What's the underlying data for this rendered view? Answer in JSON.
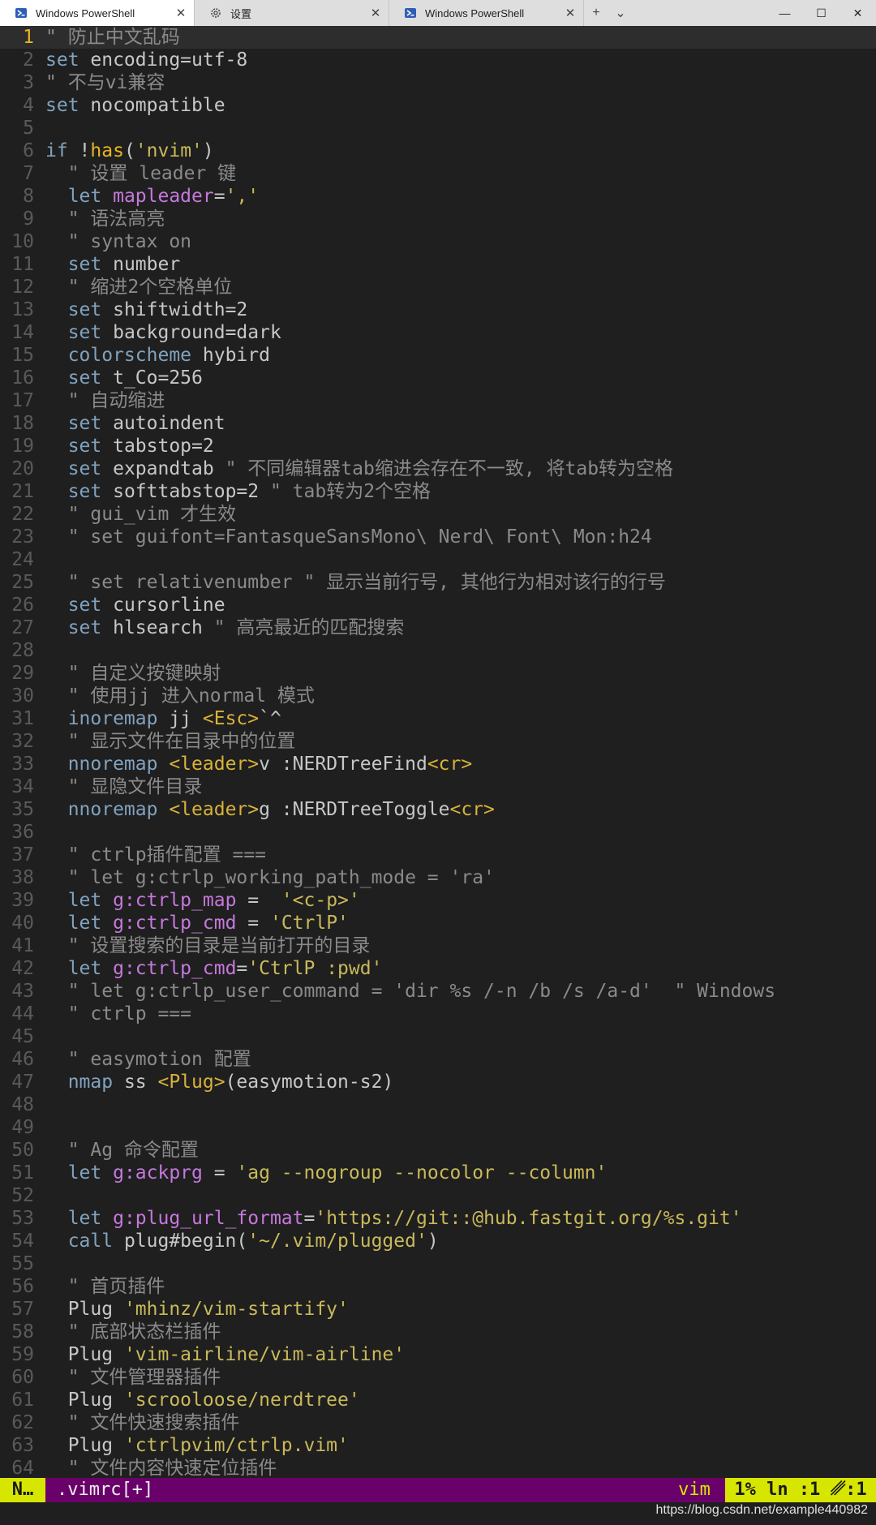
{
  "tabs": [
    {
      "label": "Windows PowerShell",
      "icon": "powershell-icon",
      "active": true
    },
    {
      "label": "设置",
      "icon": "gear-icon",
      "active": false
    },
    {
      "label": "Windows PowerShell",
      "icon": "powershell-icon",
      "active": false
    }
  ],
  "tab_close_glyph": "✕",
  "new_tab_glyph": "+",
  "dropdown_glyph": "⌄",
  "window_controls": {
    "minimize": "—",
    "maximize": "☐",
    "close": "✕"
  },
  "editor_lines": [
    [
      [
        "c",
        "\" 防止中文乱码"
      ]
    ],
    [
      [
        "k",
        "set "
      ],
      [
        "o",
        "encoding=utf-8"
      ]
    ],
    [
      [
        "c",
        "\" 不与vi兼容"
      ]
    ],
    [
      [
        "k",
        "set "
      ],
      [
        "o",
        "nocompatible"
      ]
    ],
    [],
    [
      [
        "k",
        "if "
      ],
      [
        "o",
        "!"
      ],
      [
        "f",
        "has"
      ],
      [
        "o",
        "("
      ],
      [
        "s",
        "'nvim'"
      ],
      [
        "o",
        ")"
      ]
    ],
    [
      [
        "c",
        "  \" 设置 leader 键"
      ]
    ],
    [
      [
        "k",
        "  let "
      ],
      [
        "v",
        "mapleader"
      ],
      [
        "o",
        "="
      ],
      [
        "s",
        "','"
      ]
    ],
    [
      [
        "c",
        "  \" 语法高亮"
      ]
    ],
    [
      [
        "c",
        "  \" syntax on"
      ]
    ],
    [
      [
        "k",
        "  set "
      ],
      [
        "o",
        "number"
      ]
    ],
    [
      [
        "c",
        "  \" 缩进2个空格单位"
      ]
    ],
    [
      [
        "k",
        "  set "
      ],
      [
        "o",
        "shiftwidth=2"
      ]
    ],
    [
      [
        "k",
        "  set "
      ],
      [
        "o",
        "background=dark"
      ]
    ],
    [
      [
        "k",
        "  colorscheme "
      ],
      [
        "o",
        "hybird"
      ]
    ],
    [
      [
        "k",
        "  set "
      ],
      [
        "o",
        "t_Co=256"
      ]
    ],
    [
      [
        "c",
        "  \" 自动缩进"
      ]
    ],
    [
      [
        "k",
        "  set "
      ],
      [
        "o",
        "autoindent"
      ]
    ],
    [
      [
        "k",
        "  set "
      ],
      [
        "o",
        "tabstop=2"
      ]
    ],
    [
      [
        "k",
        "  set "
      ],
      [
        "o",
        "expandtab "
      ],
      [
        "c",
        "\" 不同编辑器tab缩进会存在不一致, 将tab转为空格"
      ]
    ],
    [
      [
        "k",
        "  set "
      ],
      [
        "o",
        "softtabstop=2 "
      ],
      [
        "c",
        "\" tab转为2个空格"
      ]
    ],
    [
      [
        "c",
        "  \" gui_vim 才生效"
      ]
    ],
    [
      [
        "c",
        "  \" set guifont=FantasqueSansMono\\ Nerd\\ Font\\ Mon:h24"
      ]
    ],
    [],
    [
      [
        "c",
        "  \" set relativenumber \" 显示当前行号, 其他行为相对该行的行号"
      ]
    ],
    [
      [
        "k",
        "  set "
      ],
      [
        "o",
        "cursorline"
      ]
    ],
    [
      [
        "k",
        "  set "
      ],
      [
        "o",
        "hlsearch "
      ],
      [
        "c",
        "\" 高亮最近的匹配搜索"
      ]
    ],
    [],
    [
      [
        "c",
        "  \" 自定义按键映射"
      ]
    ],
    [
      [
        "c",
        "  \" 使用jj 进入normal 模式"
      ]
    ],
    [
      [
        "k",
        "  inoremap "
      ],
      [
        "o",
        "jj "
      ],
      [
        "t",
        "<Esc>"
      ],
      [
        "o",
        "`^"
      ]
    ],
    [
      [
        "c",
        "  \" 显示文件在目录中的位置"
      ]
    ],
    [
      [
        "k",
        "  nnoremap "
      ],
      [
        "t",
        "<leader>"
      ],
      [
        "o",
        "v :NERDTreeFind"
      ],
      [
        "t",
        "<cr>"
      ]
    ],
    [
      [
        "c",
        "  \" 显隐文件目录"
      ]
    ],
    [
      [
        "k",
        "  nnoremap "
      ],
      [
        "t",
        "<leader>"
      ],
      [
        "o",
        "g :NERDTreeToggle"
      ],
      [
        "t",
        "<cr>"
      ]
    ],
    [],
    [
      [
        "c",
        "  \" ctrlp插件配置 ==="
      ]
    ],
    [
      [
        "c",
        "  \" let g:ctrlp_working_path_mode = 'ra'"
      ]
    ],
    [
      [
        "k",
        "  let "
      ],
      [
        "v",
        "g:ctrlp_map"
      ],
      [
        "o",
        " =  "
      ],
      [
        "s",
        "'<c-p>'"
      ]
    ],
    [
      [
        "k",
        "  let "
      ],
      [
        "v",
        "g:ctrlp_cmd"
      ],
      [
        "o",
        " = "
      ],
      [
        "s",
        "'CtrlP'"
      ]
    ],
    [
      [
        "c",
        "  \" 设置搜索的目录是当前打开的目录"
      ]
    ],
    [
      [
        "k",
        "  let "
      ],
      [
        "v",
        "g:ctrlp_cmd"
      ],
      [
        "o",
        "="
      ],
      [
        "s",
        "'CtrlP :pwd'"
      ]
    ],
    [
      [
        "c",
        "  \" let g:ctrlp_user_command = 'dir %s /-n /b /s /a-d'  \" Windows"
      ]
    ],
    [
      [
        "c",
        "  \" ctrlp ==="
      ]
    ],
    [],
    [
      [
        "c",
        "  \" easymotion 配置"
      ]
    ],
    [
      [
        "k",
        "  nmap "
      ],
      [
        "o",
        "ss "
      ],
      [
        "t",
        "<Plug>"
      ],
      [
        "o",
        "(easymotion-s2)"
      ]
    ],
    [],
    [],
    [
      [
        "c",
        "  \" Ag 命令配置"
      ]
    ],
    [
      [
        "k",
        "  let "
      ],
      [
        "v",
        "g:ackprg"
      ],
      [
        "o",
        " = "
      ],
      [
        "s",
        "'ag --nogroup --nocolor --column'"
      ]
    ],
    [],
    [
      [
        "k",
        "  let "
      ],
      [
        "v",
        "g:plug_url_format"
      ],
      [
        "o",
        "="
      ],
      [
        "s",
        "'https://git::@hub.fastgit.org/%s.git'"
      ]
    ],
    [
      [
        "k",
        "  call "
      ],
      [
        "o",
        "plug#begin("
      ],
      [
        "s",
        "'~/.vim/plugged'"
      ],
      [
        "o",
        ")"
      ]
    ],
    [],
    [
      [
        "c",
        "  \" 首页插件"
      ]
    ],
    [
      [
        "o",
        "  Plug "
      ],
      [
        "s",
        "'mhinz/vim-startify'"
      ]
    ],
    [
      [
        "c",
        "  \" 底部状态栏插件"
      ]
    ],
    [
      [
        "o",
        "  Plug "
      ],
      [
        "s",
        "'vim-airline/vim-airline'"
      ]
    ],
    [
      [
        "c",
        "  \" 文件管理器插件"
      ]
    ],
    [
      [
        "o",
        "  Plug "
      ],
      [
        "s",
        "'scrooloose/nerdtree'"
      ]
    ],
    [
      [
        "c",
        "  \" 文件快速搜索插件"
      ]
    ],
    [
      [
        "o",
        "  Plug "
      ],
      [
        "s",
        "'ctrlpvim/ctrlp.vim'"
      ]
    ],
    [
      [
        "c",
        "  \" 文件内容快速定位插件"
      ]
    ]
  ],
  "cursor_line": 1,
  "statusline": {
    "mode": "N…",
    "filename": ".vimrc[+]",
    "filetype": "vim",
    "position": "1% ln :1 ␥:1"
  },
  "watermark": "https://blog.csdn.net/example440982"
}
